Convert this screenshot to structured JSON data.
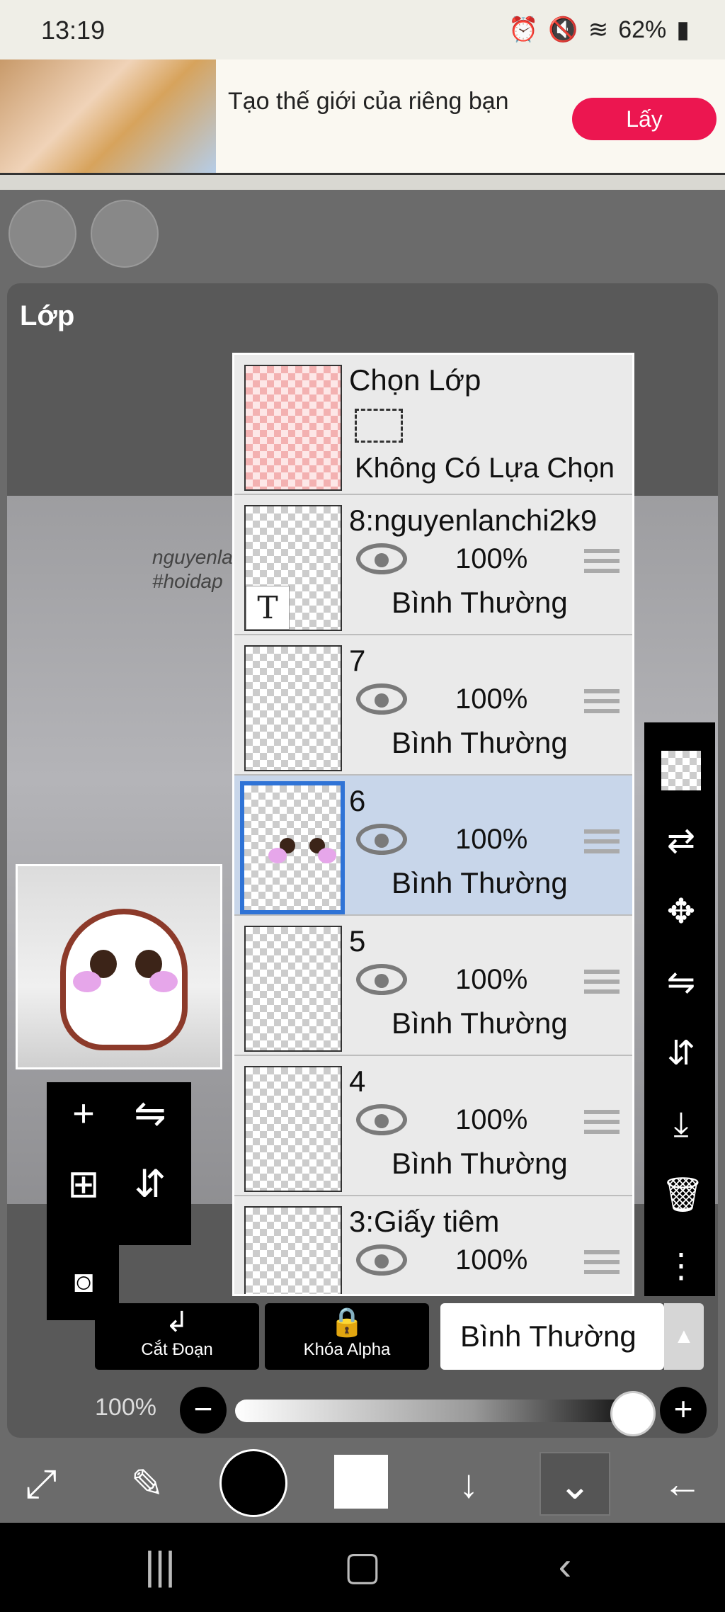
{
  "status": {
    "time": "13:19",
    "battery": "62%",
    "icons": [
      "image-icon",
      "alarm-icon",
      "mute-icon",
      "wifi-icon",
      "signal-icon",
      "battery-icon"
    ]
  },
  "ad": {
    "text": "Tạo thế giới của riêng bạn",
    "button": "Lấy"
  },
  "panel": {
    "title": "Lớp",
    "watermark_line1": "nguyenla",
    "watermark_line2": "#hoidap"
  },
  "layers": {
    "selection": {
      "name": "Chọn Lớp",
      "status": "Không Có Lựa Chọn"
    },
    "items": [
      {
        "name": "8:nguyenlanchi2k9",
        "opacity": "100%",
        "mode": "Bình Thường"
      },
      {
        "name": "7",
        "opacity": "100%",
        "mode": "Bình Thường"
      },
      {
        "name": "6",
        "opacity": "100%",
        "mode": "Bình Thường"
      },
      {
        "name": "5",
        "opacity": "100%",
        "mode": "Bình Thường"
      },
      {
        "name": "4",
        "opacity": "100%",
        "mode": "Bình Thường"
      },
      {
        "name": "3:Giấy tiêm",
        "opacity": "100%",
        "mode": ""
      }
    ]
  },
  "controls": {
    "clip_label": "Cắt Đoạn",
    "alpha_lock_label": "Khóa Alpha",
    "blend_mode": "Bình Thường",
    "opacity_value": "100%",
    "opacity_fraction": 1.0
  },
  "colors": {
    "accent": "#2f73d6",
    "ad_button": "#ec1650",
    "primary_color": "#000000",
    "secondary_color": "#ffffff"
  }
}
